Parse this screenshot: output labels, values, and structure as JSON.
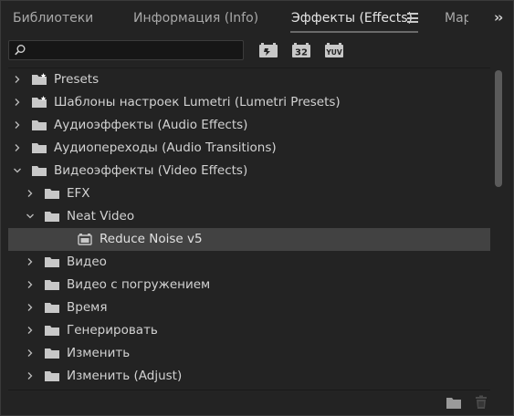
{
  "tabs": {
    "libraries": "Библиотеки",
    "info": "Информация (Info)",
    "effects": "Эффекты (Effects)",
    "markers": "Мар"
  },
  "search": {
    "value": "",
    "placeholder": ""
  },
  "filters": {
    "accelerated": "",
    "bit32": "32",
    "yuv": "YUV"
  },
  "tree": [
    {
      "label": "Presets",
      "depth": 0,
      "expanded": false,
      "icon": "star-folder-icon"
    },
    {
      "label": "Шаблоны настроек Lumetri (Lumetri Presets)",
      "depth": 0,
      "expanded": false,
      "icon": "star-folder-icon"
    },
    {
      "label": "Аудиоэффекты (Audio Effects)",
      "depth": 0,
      "expanded": false,
      "icon": "folder-icon"
    },
    {
      "label": "Аудиопереходы (Audio Transitions)",
      "depth": 0,
      "expanded": false,
      "icon": "folder-icon"
    },
    {
      "label": "Видеоэффекты (Video Effects)",
      "depth": 0,
      "expanded": true,
      "icon": "folder-icon"
    },
    {
      "label": "EFX",
      "depth": 1,
      "expanded": false,
      "icon": "folder-icon"
    },
    {
      "label": "Neat Video",
      "depth": 1,
      "expanded": true,
      "icon": "folder-icon"
    },
    {
      "label": "Reduce Noise v5",
      "depth": 2,
      "expanded": null,
      "icon": "effect-icon",
      "selected": true
    },
    {
      "label": "Видео",
      "depth": 1,
      "expanded": false,
      "icon": "folder-icon"
    },
    {
      "label": "Видео с погружением",
      "depth": 1,
      "expanded": false,
      "icon": "folder-icon"
    },
    {
      "label": "Время",
      "depth": 1,
      "expanded": false,
      "icon": "folder-icon"
    },
    {
      "label": "Генерировать",
      "depth": 1,
      "expanded": false,
      "icon": "folder-icon"
    },
    {
      "label": "Изменить",
      "depth": 1,
      "expanded": false,
      "icon": "folder-icon"
    },
    {
      "label": "Изменить (Adjust)",
      "depth": 1,
      "expanded": false,
      "icon": "folder-icon"
    }
  ],
  "colors": {
    "background": "#232323",
    "selected_row": "#424242",
    "text": "#d2d2d2",
    "icon": "#c8c8c8"
  }
}
